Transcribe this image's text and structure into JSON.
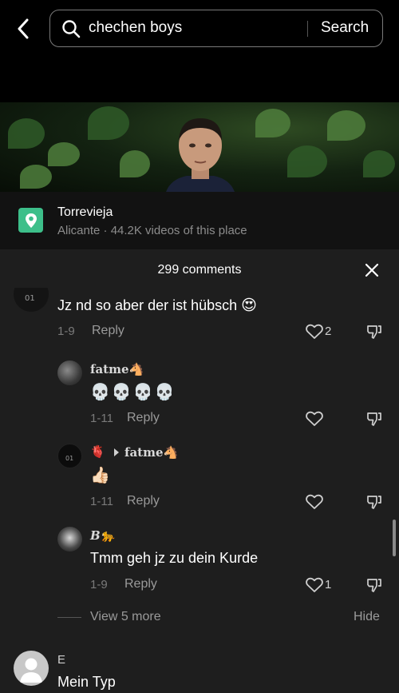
{
  "search": {
    "query": "chechen boys",
    "button_label": "Search"
  },
  "place": {
    "name": "Torrevieja",
    "subtitle": "Alicante · 44.2K videos of this place"
  },
  "comments": {
    "count_label": "299 comments",
    "items": [
      {
        "username": "",
        "text": "Jz nd so aber der ist hübsch",
        "emoji": "😍",
        "date": "1-9",
        "reply_label": "Reply",
        "likes": "2"
      },
      {
        "username": "fatme🐴",
        "text": "💀💀💀💀",
        "date": "1-11",
        "reply_label": "Reply",
        "likes": ""
      },
      {
        "username": "🫀",
        "reply_to": "fatme🐴",
        "text": "👍🏻",
        "date": "1-11",
        "reply_label": "Reply",
        "likes": ""
      },
      {
        "username": "B🐆",
        "text": "Tmm geh jz zu dein Kurde",
        "date": "1-9",
        "reply_label": "Reply",
        "likes": "1"
      },
      {
        "username": "E",
        "text": "Mein Typ"
      }
    ],
    "view_more_label": "View 5 more",
    "hide_label": "Hide"
  },
  "colors": {
    "background": "#000000",
    "sheet": "#1e1e1e",
    "place_icon": "#3dbf8a",
    "muted_text": "#9a9a9a"
  },
  "icons": [
    "chevron-left-icon",
    "search-icon",
    "location-pin-icon",
    "close-icon",
    "heart-icon",
    "dislike-icon",
    "play-icon"
  ]
}
